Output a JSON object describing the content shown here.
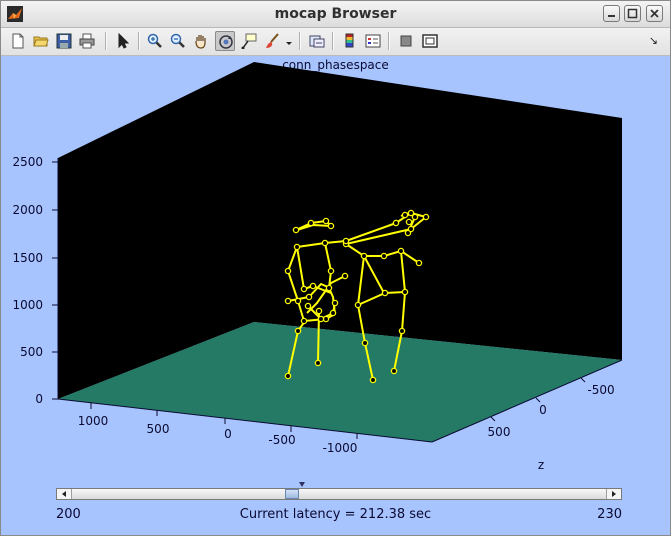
{
  "window": {
    "title": "mocap Browser",
    "buttons": [
      "minimize",
      "maximize",
      "close"
    ]
  },
  "toolbar": {
    "items": [
      {
        "name": "new-figure",
        "icon": "new-document-icon"
      },
      {
        "name": "open-file",
        "icon": "folder-open-icon"
      },
      {
        "name": "save-figure",
        "icon": "floppy-disk-icon"
      },
      {
        "name": "print-figure",
        "icon": "printer-icon"
      },
      {
        "name": "edit-plot",
        "icon": "pointer-arrow-icon"
      },
      {
        "name": "zoom-in",
        "icon": "zoom-in-icon"
      },
      {
        "name": "zoom-out",
        "icon": "zoom-out-icon"
      },
      {
        "name": "pan",
        "icon": "hand-icon"
      },
      {
        "name": "rotate-3d",
        "icon": "rotate-3d-icon",
        "active": true
      },
      {
        "name": "data-cursor",
        "icon": "data-cursor-icon"
      },
      {
        "name": "brush",
        "icon": "brush-icon"
      },
      {
        "name": "link-plot",
        "icon": "link-plot-icon"
      },
      {
        "name": "insert-colorbar",
        "icon": "colorbar-icon"
      },
      {
        "name": "insert-legend",
        "icon": "legend-icon"
      },
      {
        "name": "hide-plot-tools",
        "icon": "hide-tools-icon"
      },
      {
        "name": "show-plot-tools",
        "icon": "show-tools-icon"
      }
    ],
    "dock_arrow": "↘"
  },
  "plot": {
    "title": "conn_phasespace",
    "y_ticks": [
      "0",
      "500",
      "1000",
      "1500",
      "2000",
      "2500"
    ],
    "x_ticks": [
      "1000",
      "500",
      "0",
      "-500",
      "-1000"
    ],
    "z_ticks": [
      "500",
      "0",
      "-500"
    ],
    "z_label": "z",
    "colors": {
      "background": "#a8c4ff",
      "walls": "#000000",
      "floor": "#257a66",
      "skeleton": "#ffff00",
      "text": "#0a0a32"
    }
  },
  "slider": {
    "min_label": "200",
    "max_label": "230",
    "value_fraction": 0.41
  },
  "status": {
    "latency": "Current latency = 212.38 sec"
  }
}
